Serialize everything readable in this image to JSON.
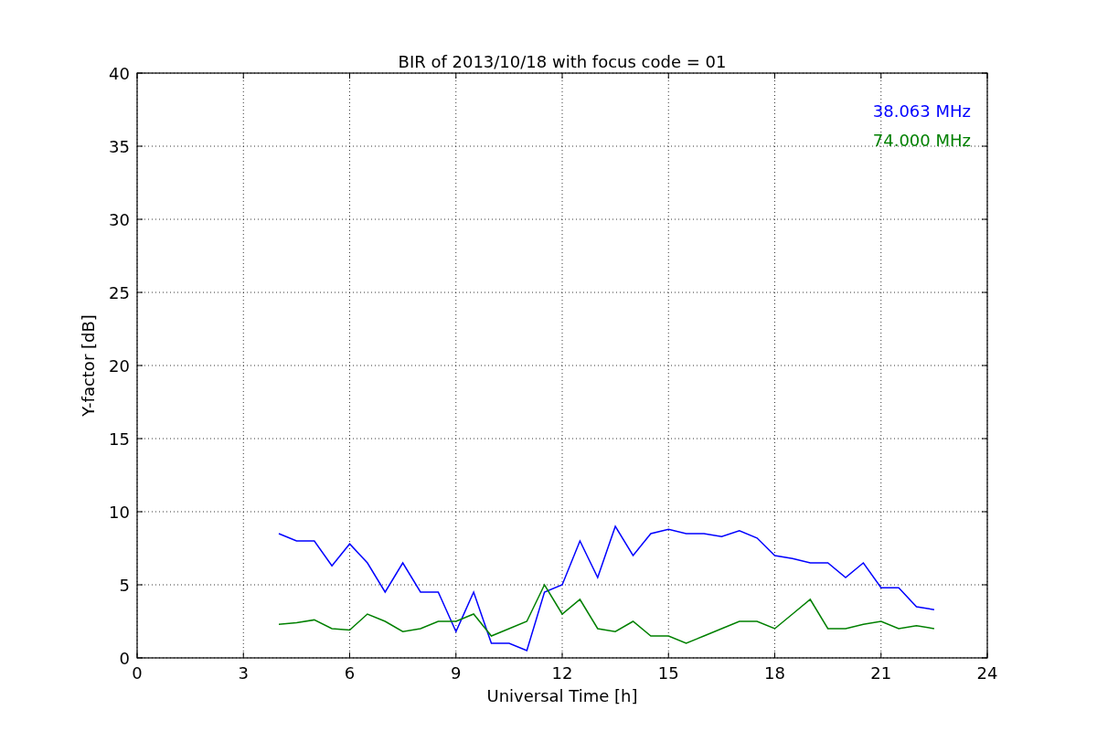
{
  "figure": {
    "chart_data": {
      "type": "line",
      "title": "BIR of 2013/10/18 with focus code = 01",
      "xlabel": "Universal Time [h]",
      "ylabel": "Y-factor [dB]",
      "x": [
        4,
        4.5,
        5,
        5.5,
        6,
        6.5,
        7,
        7.5,
        8,
        8.5,
        9,
        9.5,
        10,
        10.5,
        11,
        11.5,
        12,
        12.5,
        13,
        13.5,
        14,
        14.5,
        15,
        15.5,
        16,
        16.5,
        17,
        17.5,
        18,
        18.5,
        19,
        19.5,
        20,
        20.5,
        21,
        21.5,
        22,
        22.5
      ],
      "series": [
        {
          "name": "38.063 MHz",
          "color": "#0000ff",
          "values": [
            8.5,
            8,
            8,
            6.3,
            7.8,
            6.5,
            4.5,
            6.5,
            4.5,
            4.5,
            1.8,
            4.5,
            1,
            1,
            0.5,
            4.5,
            5,
            8,
            5.5,
            9,
            7,
            8.5,
            8.8,
            8.5,
            8.5,
            8.3,
            8.7,
            8.2,
            7,
            6.8,
            6.5,
            6.5,
            5.5,
            6.5,
            4.8,
            4.8,
            3.5,
            3.3
          ]
        },
        {
          "name": "74.000 MHz",
          "color": "#008000",
          "values": [
            2.3,
            2.4,
            2.6,
            2,
            1.9,
            3,
            2.5,
            1.8,
            2,
            2.5,
            2.5,
            3,
            1.5,
            2,
            2.5,
            5,
            3,
            4,
            2,
            1.8,
            2.5,
            1.5,
            1.5,
            1,
            1.5,
            2,
            2.5,
            2.5,
            2,
            3,
            4,
            2,
            2,
            2.3,
            2.5,
            2,
            2.2,
            2
          ]
        }
      ],
      "grid": true,
      "xlim": [
        0,
        24
      ],
      "ylim": [
        0,
        40
      ],
      "xticks": [
        0,
        3,
        6,
        9,
        12,
        15,
        18,
        21,
        24
      ],
      "yticks": [
        0,
        5,
        10,
        15,
        20,
        25,
        30,
        35,
        40
      ]
    }
  }
}
